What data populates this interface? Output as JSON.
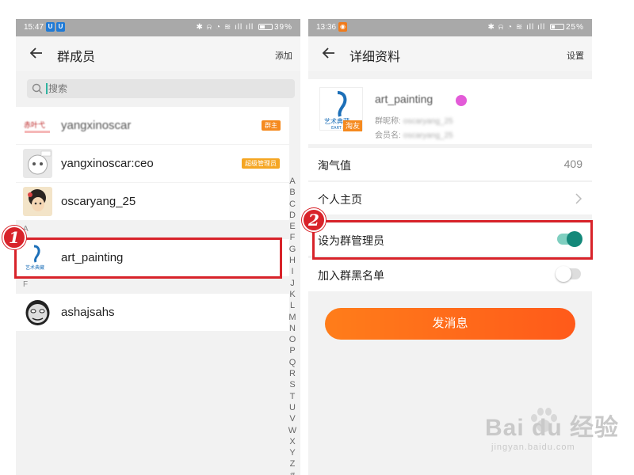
{
  "left": {
    "status_time": "15:47",
    "status_battery": "39%",
    "title": "群成员",
    "add_label": "添加",
    "search_placeholder": "搜索",
    "members": [
      {
        "name": "yangxinoscar",
        "badge": "群主",
        "blurred": true
      },
      {
        "name": "yangxinoscar:ceo",
        "badge": "超级管理员",
        "blurred": false
      },
      {
        "name": "oscaryang_25",
        "badge": "",
        "blurred": false
      },
      {
        "name": "art_painting",
        "badge": "",
        "blurred": false
      },
      {
        "name": "ashajsahs",
        "badge": "",
        "blurred": false
      }
    ],
    "section_a": "A",
    "section_f": "F",
    "index_letters": [
      "A",
      "B",
      "C",
      "D",
      "E",
      "F",
      "G",
      "H",
      "I",
      "J",
      "K",
      "L",
      "M",
      "N",
      "O",
      "P",
      "Q",
      "R",
      "S",
      "T",
      "U",
      "V",
      "W",
      "X",
      "Y",
      "Z",
      "#"
    ],
    "step_number": "1"
  },
  "right": {
    "status_time": "13:36",
    "status_battery": "25%",
    "title": "详细资料",
    "settings_label": "设置",
    "profile": {
      "name": "art_painting",
      "friend_tag": "淘友",
      "nickname_label": "群昵称:",
      "nickname_value": "oscaryang_25",
      "member_label": "会员名:",
      "member_value": "oscaryang_25"
    },
    "taoqi_label": "淘气值",
    "taoqi_value": "409",
    "homepage_label": "个人主页",
    "set_admin_label": "设为群管理员",
    "set_admin_on": true,
    "blacklist_label": "加入群黑名单",
    "blacklist_on": false,
    "send_button": "发消息",
    "step_number": "2"
  },
  "colors": {
    "accent_teal": "#14897a",
    "highlight_red": "#d8232a",
    "orange": "#ff6a1a",
    "badge_orange": "#f58a1f"
  },
  "watermark": {
    "main": "Bai du 经验",
    "sub": "jingyan.baidu.com"
  }
}
